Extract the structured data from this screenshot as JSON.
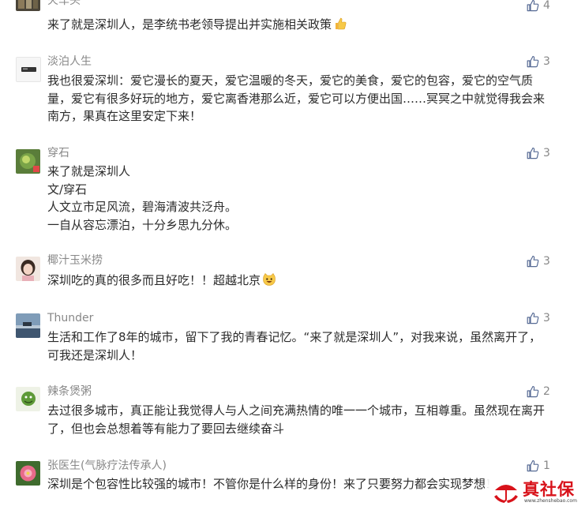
{
  "comments": [
    {
      "nickname": "火车头",
      "likes": "4",
      "text": "来了就是深圳人，是李统书老领导提出并实施相关政策"
    },
    {
      "nickname": "淡泊人生",
      "likes": "3",
      "text": "我也很爱深圳：爱它漫长的夏天，爱它温暖的冬天，爱它的美食，爱它的包容，爱它的空气质量，爱它有很多好玩的地方，爱它离香港那么近，爱它可以方便出国……冥冥之中就觉得我会来南方，果真在这里安定下来！"
    },
    {
      "nickname": "穿石",
      "likes": "3",
      "text": "来了就是深圳人\n文/穿石\n人文立市足风流，碧海清波共泛舟。\n一自从容忘漂泊，十分乡思九分休。"
    },
    {
      "nickname": "椰汁玉米捞",
      "likes": "3",
      "text": "深圳吃的真的很多而且好吃！！超越北京"
    },
    {
      "nickname": "Thunder",
      "likes": "3",
      "text": "生活和工作了8年的城市，留下了我的青春记忆。“来了就是深圳人”，对我来说，虽然离开了，可我还是深圳人！"
    },
    {
      "nickname": "辣条煲粥",
      "likes": "2",
      "text": "去过很多城市，真正能让我觉得人与人之间充满热情的唯一一个城市，互相尊重。虽然现在离开了，但也会总想着等有能力了要回去继续奋斗"
    },
    {
      "nickname": "张医生(气脉疗法传承人)",
      "likes": "1",
      "text": "深圳是个包容性比较强的城市！不管你是什么样的身份！来了只要努力都会实现梦想！"
    }
  ],
  "icons": {
    "like": "thumbs-up-outline-icon",
    "emoji_1": "thumbs-up-emoji",
    "emoji_2": "grinning-cat-emoji"
  },
  "colors": {
    "text": "#2b2b2b",
    "meta": "#888888",
    "like_icon": "#576b95",
    "watermark": "#d8121a"
  },
  "watermark": {
    "title": "真社保",
    "url": "www.zhenshebao.com"
  }
}
